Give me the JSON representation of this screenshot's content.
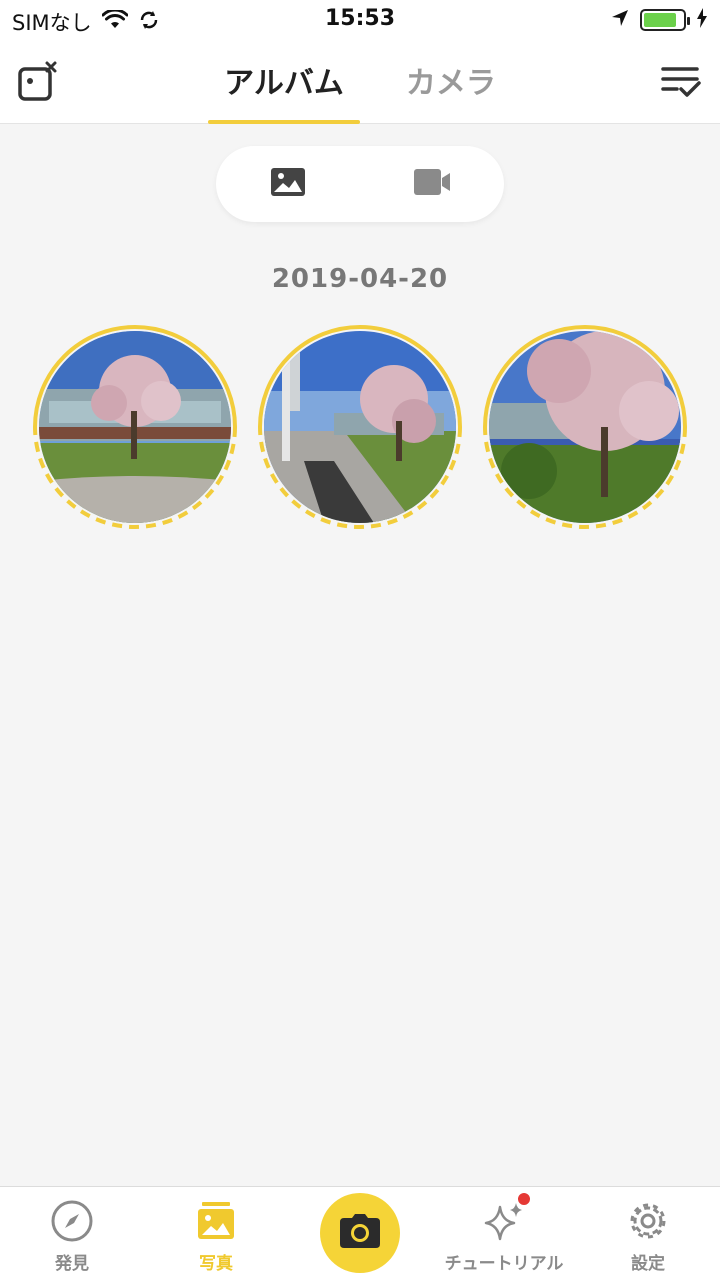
{
  "status_bar": {
    "carrier": "SIMなし",
    "time": "15:53",
    "battery_level": 0.85
  },
  "header": {
    "left_icon": "camera-disconnect-icon",
    "right_icon": "select-checklist-icon",
    "tabs": [
      {
        "label": "アルバム",
        "active": true
      },
      {
        "label": "カメラ",
        "active": false
      }
    ]
  },
  "segment": {
    "options": [
      {
        "icon": "photo-icon",
        "active": true
      },
      {
        "icon": "video-icon",
        "active": false
      }
    ]
  },
  "album": {
    "date": "2019-04-20",
    "items": [
      {
        "type": "360-photo"
      },
      {
        "type": "360-photo"
      },
      {
        "type": "360-photo"
      }
    ]
  },
  "bottom_nav": {
    "items": [
      {
        "label": "発見",
        "icon": "compass-icon",
        "active": false
      },
      {
        "label": "写真",
        "icon": "album-icon",
        "active": true
      },
      {
        "label": "チュートリアル",
        "icon": "sparkle-icon",
        "active": false,
        "badge": true
      },
      {
        "label": "設定",
        "icon": "gear-icon",
        "active": false
      }
    ],
    "center_icon": "camera-icon"
  },
  "colors": {
    "accent": "#f2cd3c",
    "badge": "#e53935",
    "background": "#f5f5f5"
  }
}
